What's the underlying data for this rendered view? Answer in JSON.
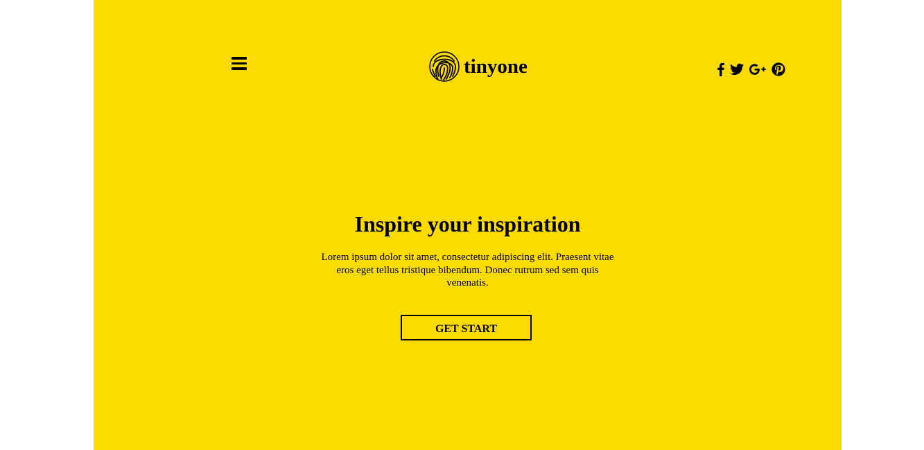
{
  "header": {
    "menu_icon": "hamburger-icon",
    "brand": {
      "logo_icon": "fingerprint-icon",
      "name": "tinyone"
    },
    "social": [
      {
        "name": "facebook",
        "icon": "facebook-icon"
      },
      {
        "name": "twitter",
        "icon": "twitter-icon"
      },
      {
        "name": "google-plus",
        "icon": "google-plus-icon"
      },
      {
        "name": "pinterest",
        "icon": "pinterest-icon"
      }
    ]
  },
  "hero": {
    "title": "Inspire your inspiration",
    "text": "Lorem ipsum dolor sit amet, consectetur adipiscing elit. Praesent vitae eros eget tellus tristique bibendum. Donec rutrum sed sem quis venenatis.",
    "cta_label": "GET START"
  },
  "colors": {
    "background": "#fcdc00",
    "page_outer": "#ffffff",
    "text": "#000000"
  }
}
